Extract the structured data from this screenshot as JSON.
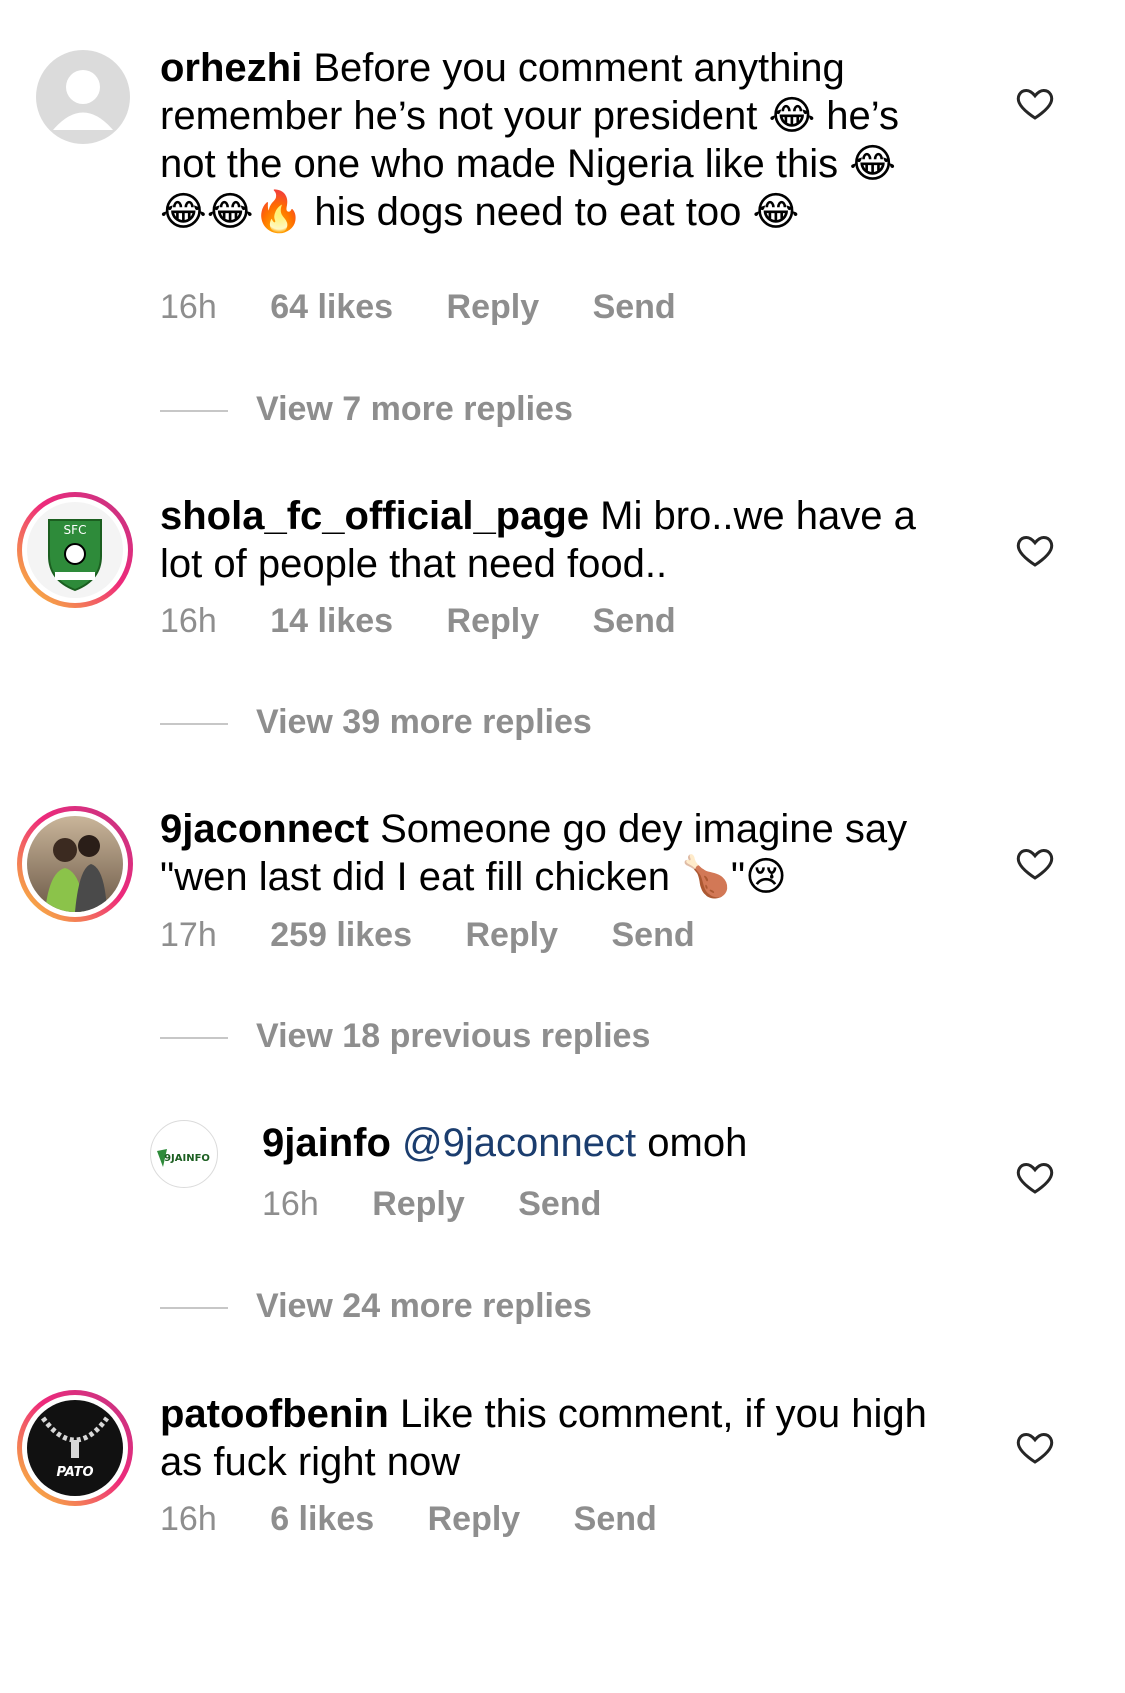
{
  "comments": [
    {
      "username": "orhezhi",
      "text": "Before you comment anything remember he’s not your president 😂 he’s not the one who made Nigeria like this 😂😂😂🔥 his dogs need to eat too 😂",
      "time": "16h",
      "likes": "64 likes",
      "reply": "Reply",
      "send": "Send",
      "view_replies": "View 7 more replies"
    },
    {
      "username": "shola_fc_official_page",
      "text": "Mi bro..we have a lot of people that need food..",
      "time": "16h",
      "likes": "14 likes",
      "reply": "Reply",
      "send": "Send",
      "view_replies": "View 39 more replies",
      "avatar_text": "SFC"
    },
    {
      "username": "9jaconnect",
      "text": "Someone go dey imagine say \"wen last did I eat fill chicken 🍗\"😢",
      "time": "17h",
      "likes": "259 likes",
      "reply": "Reply",
      "send": "Send",
      "view_replies": "View 18 previous replies"
    },
    {
      "username": "patoofbenin",
      "text": "Like this comment, if you high as fuck right now",
      "time": "16h",
      "likes": "6 likes",
      "reply": "Reply",
      "send": "Send",
      "avatar_text": "PATO"
    }
  ],
  "reply": {
    "username": "9jainfo",
    "mention": "@9jaconnect",
    "text": "omoh",
    "time": "16h",
    "reply": "Reply",
    "send": "Send",
    "view_replies": "View 24 more replies",
    "avatar_text": "9JAINFO"
  },
  "colors": {
    "meta": "#8e8e8e",
    "mention": "#1b3d6e",
    "ring_start": "#f9ce34",
    "ring_end": "#c13584"
  }
}
